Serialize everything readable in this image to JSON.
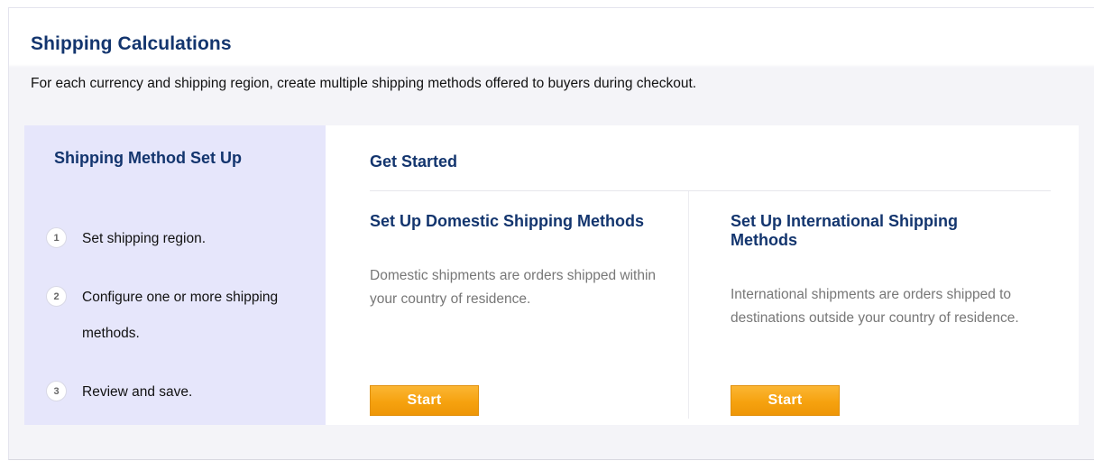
{
  "header": {
    "title": "Shipping Calculations",
    "description": "For each currency and shipping region, create multiple shipping methods offered to buyers during checkout."
  },
  "steps_panel": {
    "title": "Shipping Method Set Up",
    "steps": [
      {
        "number": "1",
        "label": "Set shipping region."
      },
      {
        "number": "2",
        "label": "Configure one or more shipping methods."
      },
      {
        "number": "3",
        "label": "Review and save."
      }
    ]
  },
  "main": {
    "heading": "Get Started",
    "domestic": {
      "title": "Set Up Domestic Shipping Methods",
      "description": "Domestic shipments are orders shipped within your country of residence.",
      "button_label": "Start"
    },
    "international": {
      "title": "Set Up International Shipping Methods",
      "description": "International shipments are orders shipped to destinations outside your country of residence.",
      "button_label": "Start"
    }
  },
  "colors": {
    "heading": "#13356e",
    "steps_background": "#e6e6fb",
    "start_button": "#f6a20f"
  }
}
